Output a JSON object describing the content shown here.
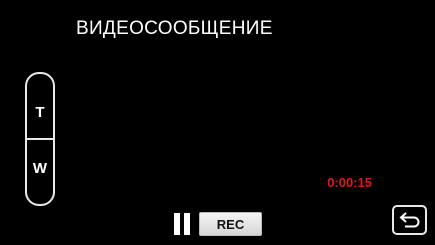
{
  "screen": {
    "title": "ВИДЕОСООБЩЕНИЕ"
  },
  "zoom": {
    "tele_label": "T",
    "wide_label": "W"
  },
  "recording": {
    "timecode": "0:00:15",
    "timecode_color": "#e01818",
    "rec_label": "REC",
    "pause_icon": "pause-icon"
  },
  "navigation": {
    "back_icon": "return-arrow-icon"
  }
}
